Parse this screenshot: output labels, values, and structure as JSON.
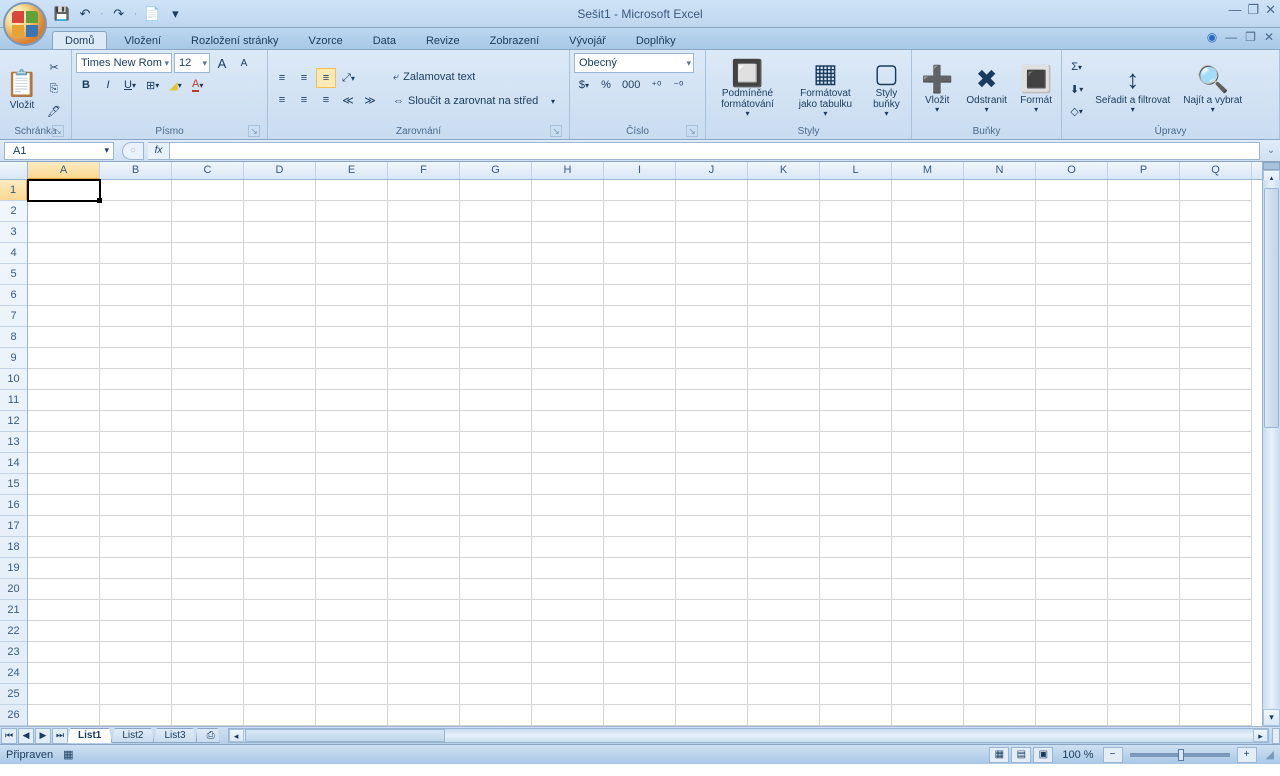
{
  "title": "Sešit1 - Microsoft Excel",
  "qat": {
    "save": "💾",
    "undo": "↶",
    "redo": "↷",
    "new": "📄",
    "more": "▾"
  },
  "tabs": {
    "items": [
      "Domů",
      "Vložení",
      "Rozložení stránky",
      "Vzorce",
      "Data",
      "Revize",
      "Zobrazení",
      "Vývojář",
      "Doplňky"
    ],
    "active": 0
  },
  "window": {
    "minimize": "—",
    "restore": "❐",
    "close": "✕"
  },
  "ribbon": {
    "clipboard": {
      "label": "Schránka",
      "paste": "Vložit",
      "cut": "✂",
      "copy": "⎘",
      "painter": "🖊"
    },
    "font": {
      "label": "Písmo",
      "family": "Times New Rom",
      "size": "12",
      "grow": "A",
      "shrink": "A",
      "bold": "B",
      "italic": "I",
      "underline": "U",
      "border": "⊞",
      "fill": "◢",
      "color": "A"
    },
    "align": {
      "label": "Zarovnání",
      "tl": "≡",
      "tc": "≡",
      "tr": "≡",
      "orient": "⤢",
      "wrap": "Zalamovat text",
      "l": "≡",
      "c": "≡",
      "r": "≡",
      "indL": "≪",
      "indR": "≫",
      "merge": "Sloučit a zarovnat na střed"
    },
    "number": {
      "label": "Číslo",
      "format": "Obecný",
      "currency": "$",
      "percent": "%",
      "comma": "000",
      "incDec": "⁺⁰",
      "decDec": "⁻⁰"
    },
    "styles": {
      "label": "Styly",
      "cond": "Podmíněné formátování",
      "table": "Formátovat jako tabulku",
      "cell": "Styly buňky"
    },
    "cells": {
      "label": "Buňky",
      "insert": "Vložit",
      "delete": "Odstranit",
      "format": "Formát"
    },
    "editing": {
      "label": "Úpravy",
      "sum": "Σ",
      "fill": "⬇",
      "clear": "◇",
      "sort": "Seřadit a filtrovat",
      "find": "Najít a vybrat"
    }
  },
  "namebox": "A1",
  "fx": "fx",
  "columns": [
    "A",
    "B",
    "C",
    "D",
    "E",
    "F",
    "G",
    "H",
    "I",
    "J",
    "K",
    "L",
    "M",
    "N",
    "O",
    "P",
    "Q"
  ],
  "rows": [
    "1",
    "2",
    "3",
    "4",
    "5",
    "6",
    "7",
    "8",
    "9",
    "10",
    "11",
    "12",
    "13",
    "14",
    "15",
    "16",
    "17",
    "18",
    "19",
    "20",
    "21",
    "22",
    "23",
    "24",
    "25",
    "26"
  ],
  "sheet_tabs": {
    "items": [
      "List1",
      "List2",
      "List3"
    ],
    "active": 0,
    "new": "⎙"
  },
  "status": {
    "ready": "Připraven",
    "macro": "▦",
    "zoom": "100 %",
    "views": [
      "▦",
      "▤",
      "▣"
    ],
    "minus": "−",
    "plus": "+"
  }
}
